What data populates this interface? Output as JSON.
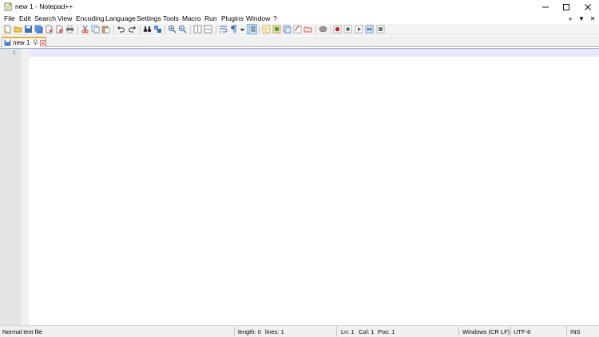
{
  "window": {
    "title": "new 1 - Notepad++",
    "minimize_icon": "minimize-icon",
    "maximize_icon": "maximize-icon",
    "close_icon": "close-icon"
  },
  "menu": {
    "items": [
      "File",
      "Edit",
      "Search",
      "View",
      "Encoding",
      "Language",
      "Settings",
      "Tools",
      "Macro",
      "Run",
      "Plugins",
      "Window",
      "?"
    ],
    "right": {
      "add": "+",
      "dropdown": "▼",
      "close": "✕"
    }
  },
  "toolbar": {
    "buttons": [
      "new-file",
      "open-file",
      "save",
      "save-all",
      "close",
      "close-all",
      "print",
      "cut",
      "copy",
      "paste",
      "undo",
      "redo",
      "find",
      "replace",
      "zoom-in",
      "zoom-out",
      "sync-vertical",
      "sync-horizontal",
      "word-wrap",
      "show-all-characters",
      "indent-guide",
      "user-defined-language",
      "document-map",
      "document-list",
      "function-list",
      "folder-as-workspace",
      "monitoring",
      "record-macro",
      "stop-recording",
      "playback-macro",
      "run-macro-multiple",
      "save-macro"
    ]
  },
  "tabs": [
    {
      "label": "new 1",
      "icon": "file-saved-icon"
    }
  ],
  "editor": {
    "line_numbers": [
      "1"
    ],
    "content": ""
  },
  "status": {
    "file_type": "Normal text file",
    "length": "length: 0",
    "lines": "lines: 1",
    "ln": "Ln: 1",
    "col": "Col: 1",
    "pos": "Pos: 1",
    "eol": "Windows (CR LF)",
    "encoding": "UTF-8",
    "mode": "INS"
  },
  "colors": {
    "tab_accent": "#f5a623",
    "current_line": "#e8e8ff",
    "gutter": "#e4e4e4"
  }
}
